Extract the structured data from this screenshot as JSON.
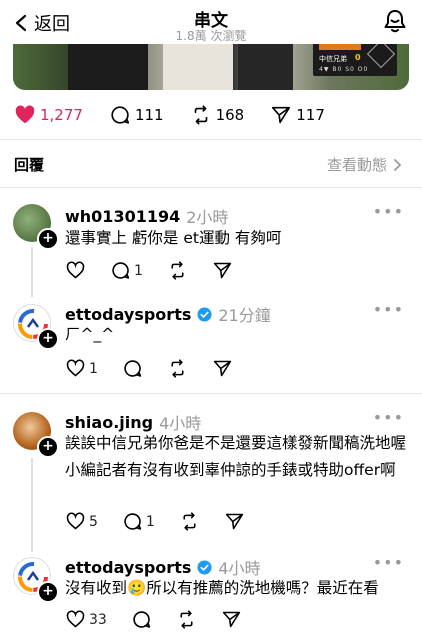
{
  "header": {
    "back_label": "返回",
    "title": "串文",
    "subtitle": "1.8萬 次瀏覽"
  },
  "post_stats": {
    "likes": "1,277",
    "comments": "111",
    "reposts": "168",
    "shares": "117"
  },
  "replies_section": {
    "heading": "回覆",
    "activity_link": "查看動態"
  },
  "replies": [
    {
      "username": "wh01301194",
      "time": "2小時",
      "text": "還事實上 虧你是 et運動 有夠呵",
      "likes": "",
      "comments": "1"
    },
    {
      "username": "ettodaysports",
      "time": "21分鐘",
      "verified": true,
      "text": "ㄏ^_^",
      "likes": "1",
      "comments": ""
    },
    {
      "username": "shiao.jing",
      "time": "4小時",
      "text": "誒誒中信兄弟你爸是不是還要這樣發新聞稿洗地喔 小編記者有沒有收到辜仲諒的手錶或特助offer啊",
      "likes": "5",
      "comments": "1"
    },
    {
      "username": "ettodaysports",
      "time": "4小時",
      "verified": true,
      "text": "沒有收到🥲所以有推薦的洗地機嗎？最近在看",
      "likes": "33",
      "comments": ""
    }
  ],
  "scoreboard": {
    "team": "中信兄弟",
    "score": "0",
    "inning": "4▼",
    "bso": "B0 S0 O0"
  },
  "colors": {
    "like_red": "#e0245e",
    "muted_gray": "#9a9a9a",
    "verified_blue": "#1d9bf0"
  }
}
